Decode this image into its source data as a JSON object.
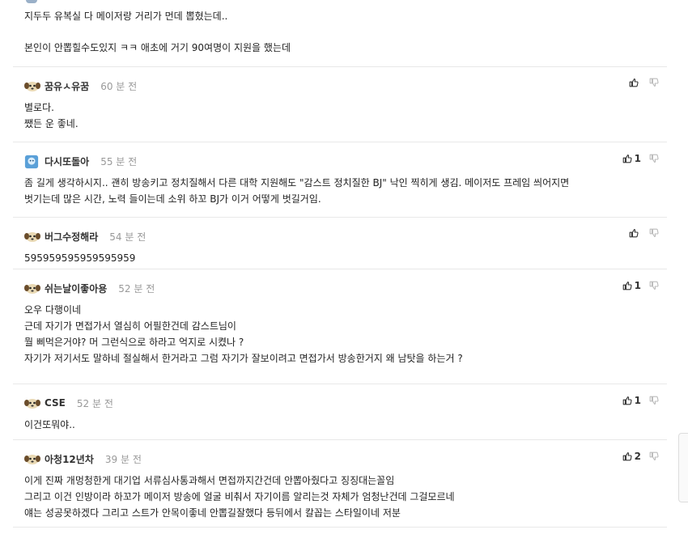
{
  "top_partial": {
    "lines": [
      "지두두 유복실 다 메이저랑 거리가 먼데 뽑혔는데..",
      "본인이 안뽑힐수도있지 ㅋㅋ 애초에 거기 90여명이 지원을 했는데"
    ]
  },
  "comments": [
    {
      "nick": "꿈유ㅅ유꿈",
      "time": "60 분 전",
      "up": "",
      "lines": [
        "별로다.",
        "쨌든 운 좋네."
      ],
      "avatar": "dog"
    },
    {
      "nick": "다시또돌아",
      "time": "55 분 전",
      "up": "1",
      "lines": [
        "좀 길게 생각하시지.. 괜히 방송키고 정치질해서 다른 대학 지원해도 \"감스트 정치질한 BJ\" 낙인 찍히게 생김. 메이저도 프레임 씌어지면",
        "벗기는데 많은 시간, 노력 들이는데 소위 하꼬 BJ가 이거 어떻게 벗길거임."
      ],
      "avatar": "blue"
    },
    {
      "nick": "버그수정해라",
      "time": "54 분 전",
      "up": "",
      "lines": [
        "595959595959595959"
      ],
      "avatar": "dog"
    },
    {
      "nick": "쉬는날이좋아용",
      "time": "52 분 전",
      "up": "1",
      "lines": [
        "오우 다행이네",
        "근데 자기가 면접가서 열심히 어필한건데 감스트님이",
        "뭘 삐먹은거야? 머 그런식으로 하라고 억지로 시켰나 ?",
        "자기가 저기서도 말하네 절실해서 한거라고 그럼 자기가 잘보이려고 면접가서 방송한거지 왜 남탓을 하는거 ?"
      ],
      "avatar": "dog"
    },
    {
      "nick": "CSE",
      "time": "52 분 전",
      "up": "1",
      "lines": [
        "이건또뭐야.."
      ],
      "avatar": "dog"
    },
    {
      "nick": "아청12년차",
      "time": "39 분 전",
      "up": "2",
      "lines": [
        "이게 진짜 개멍청한게 대기업 서류심사통과해서 면접까지간건데 안뽑아줬다고 징징대는꼴임",
        "그리고 이건 인방이라 하꼬가 메이저 방송에 얼굴 비춰서 자기이름 알리는것 자체가 엄청난건데 그걸모르네",
        "얘는 성공못하겠다 그리고 스트가 안목이좋네 안뽑길잘했다 등뒤에서 칼꼽는 스타일이네 저분"
      ],
      "avatar": "dog"
    }
  ],
  "icons": {
    "upvote": "thumbs-up-icon",
    "downvote": "thumbs-down-icon",
    "avatar_dog": "dog-avatar-icon",
    "avatar_blue": "blue-avatar-icon"
  },
  "colors": {
    "nick": "#333333",
    "time": "#999999",
    "divider": "#e8e8e8"
  }
}
